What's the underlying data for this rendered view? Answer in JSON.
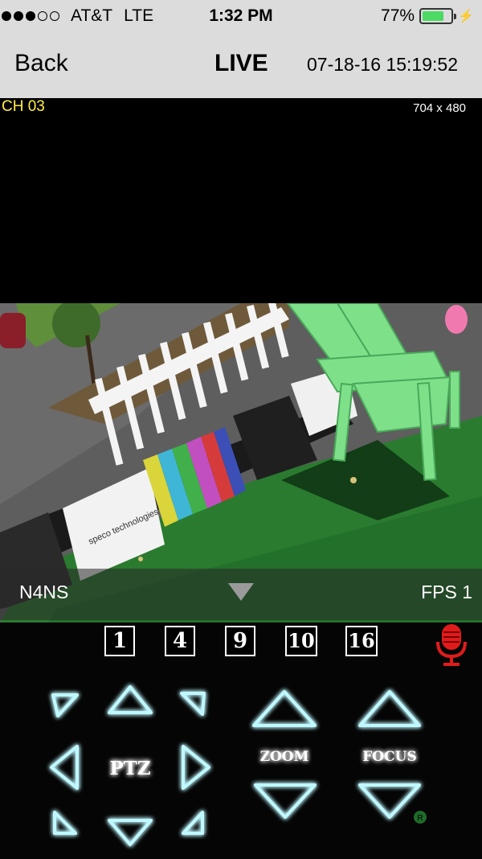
{
  "status_bar": {
    "carrier": "AT&T",
    "network": "LTE",
    "time": "1:32 PM",
    "battery_percent": "77%",
    "battery_level": 0.77,
    "signal_bars_filled": 3,
    "signal_bars_total": 5
  },
  "nav": {
    "back_label": "Back",
    "title": "LIVE",
    "datetime": "07-18-16 15:19:52"
  },
  "video": {
    "channel": "CH 03",
    "resolution": "704 x 480",
    "camera_name": "N4NS",
    "fps": "FPS 1",
    "scene_text": "speco technologies"
  },
  "layouts": [
    "1",
    "4",
    "9",
    "10",
    "16"
  ],
  "ptz": {
    "label": "PTZ",
    "zoom_label": "ZOOM",
    "focus_label": "FOCUS",
    "small_badge": "R"
  },
  "colors": {
    "glow": "#2ee8ff",
    "mic": "#e01b1b",
    "channel_text": "#ffee44",
    "status_bg": "#dcdcdc"
  }
}
